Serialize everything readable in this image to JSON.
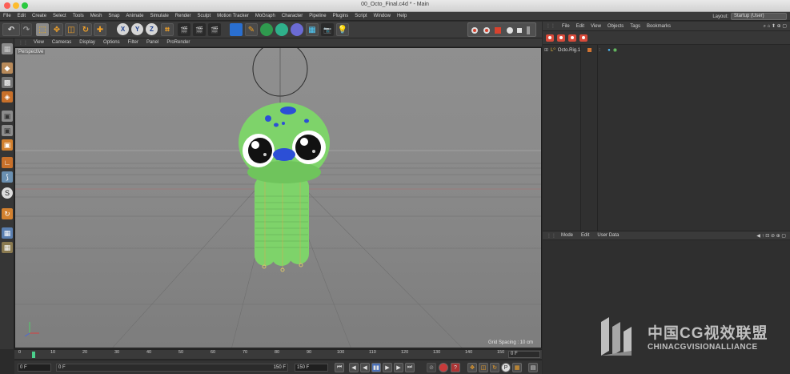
{
  "window": {
    "title": "00_Octo_Final.c4d * - Main"
  },
  "menubar": {
    "items": [
      "File",
      "Edit",
      "Create",
      "Select",
      "Tools",
      "Mesh",
      "Snap",
      "Animate",
      "Simulate",
      "Render",
      "Sculpt",
      "Motion Tracker",
      "MoGraph",
      "Character",
      "Pipeline",
      "Plugins",
      "Script",
      "Window",
      "Help"
    ],
    "layout_label": "Layout:",
    "layout_value": "Startup (User)"
  },
  "toolbar": {
    "axis_x": "X",
    "axis_y": "Y",
    "axis_z": "Z"
  },
  "viewport": {
    "menu": [
      "View",
      "Cameras",
      "Display",
      "Options",
      "Filter",
      "Panel",
      "ProRender"
    ],
    "camera_label": "Perspective",
    "grid_spacing": "Grid Spacing : 10 cm"
  },
  "timeline": {
    "ticks": [
      "0",
      "10",
      "20",
      "30",
      "40",
      "50",
      "60",
      "70",
      "80",
      "90",
      "100",
      "110",
      "120",
      "130",
      "140",
      "150"
    ],
    "current_frame_display": "0 F"
  },
  "transport": {
    "start_frame": "0 F",
    "preview_start": "0 F",
    "preview_end": "150 F",
    "end_frame": "150 F"
  },
  "object_manager": {
    "menu": [
      "File",
      "Edit",
      "View",
      "Objects",
      "Tags",
      "Bookmarks"
    ],
    "objects": [
      {
        "name": "Octo.Rig.1"
      }
    ]
  },
  "attribute_manager": {
    "menu": [
      "Mode",
      "Edit",
      "User Data"
    ]
  },
  "watermark": {
    "line1": "中国CG视效联盟",
    "line2": "CHINACGVISIONALLIANCE"
  },
  "colors": {
    "accent_orange": "#f3a32b",
    "octo_green": "#7ed36a",
    "octo_spots": "#2c4fd6",
    "timeline_marker": "#4bd08d"
  }
}
